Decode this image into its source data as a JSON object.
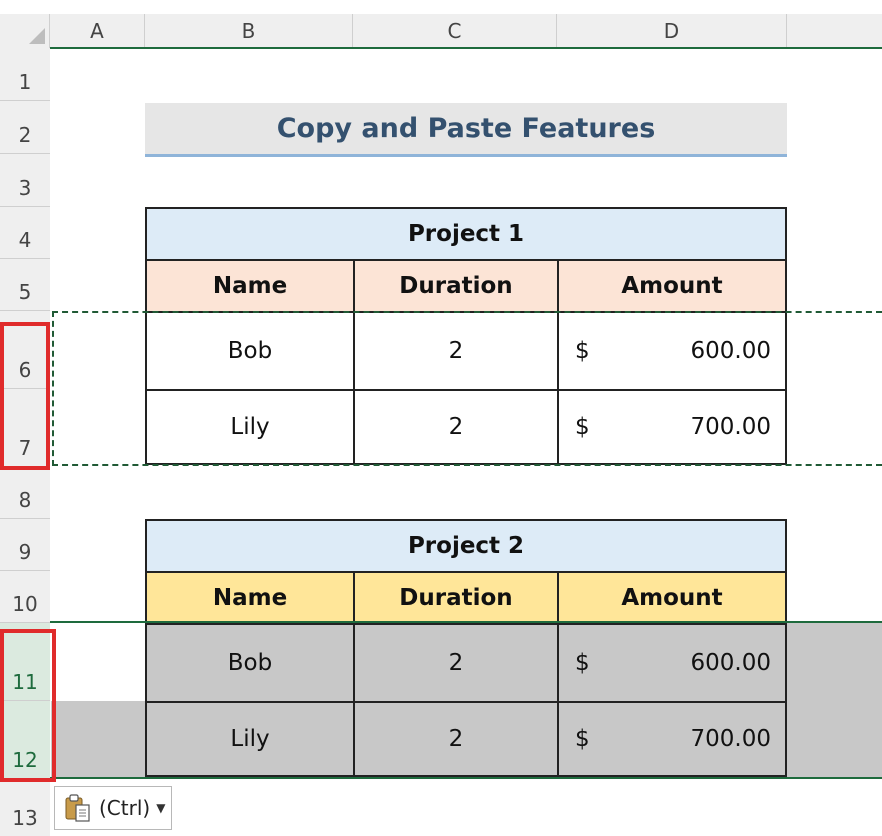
{
  "columns": [
    "A",
    "B",
    "C",
    "D"
  ],
  "rows": [
    "1",
    "2",
    "3",
    "4",
    "5",
    "6",
    "7",
    "8",
    "9",
    "10",
    "11",
    "12",
    "13"
  ],
  "title": "Copy and Paste Features",
  "project1": {
    "heading": "Project 1",
    "headers": [
      "Name",
      "Duration",
      "Amount"
    ],
    "rows": [
      {
        "name": "Bob",
        "duration": "2",
        "currency": "$",
        "amount": "600.00"
      },
      {
        "name": "Lily",
        "duration": "2",
        "currency": "$",
        "amount": "700.00"
      }
    ]
  },
  "project2": {
    "heading": "Project 2",
    "headers": [
      "Name",
      "Duration",
      "Amount"
    ],
    "rows": [
      {
        "name": "Bob",
        "duration": "2",
        "currency": "$",
        "amount": "600.00"
      },
      {
        "name": "Lily",
        "duration": "2",
        "currency": "$",
        "amount": "700.00"
      }
    ]
  },
  "paste_options": {
    "label": "(Ctrl)"
  },
  "colors": {
    "project_heading_fill": "#ddebf7",
    "project1_header_fill": "#fce4d6",
    "project2_header_fill": "#ffe699",
    "pasted_rows_fill": "#c8c8c8",
    "selection_green": "#1e6b3d",
    "highlight_red": "#e02b2b"
  }
}
